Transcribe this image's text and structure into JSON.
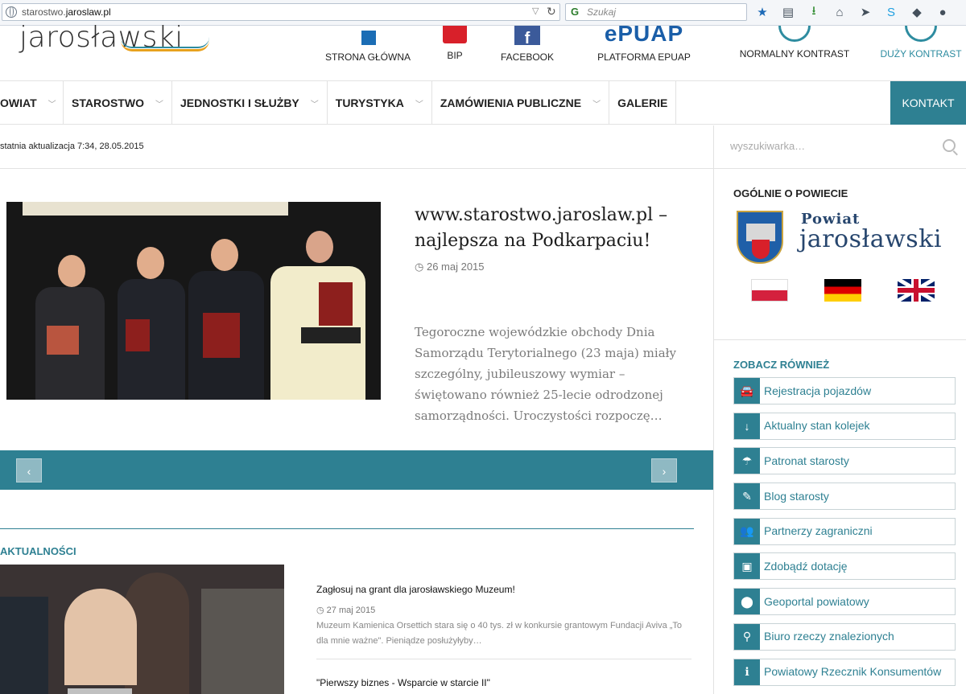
{
  "browser": {
    "url_prefix": "starostwo.",
    "url_domain": "jaroslaw.pl",
    "search_placeholder": "Szukaj",
    "toolbar_icons": [
      "star-icon",
      "reading-list-icon",
      "download-icon",
      "home-icon",
      "send-icon",
      "skype-icon",
      "pocket-icon",
      "chat-icon"
    ]
  },
  "header": {
    "logo_text": "jarosławski",
    "quick_links": [
      {
        "label": "STRONA GŁÓWNA",
        "icon": "home-icon"
      },
      {
        "label": "BIP",
        "icon": "bip-icon"
      },
      {
        "label": "FACEBOOK",
        "icon": "facebook-icon"
      },
      {
        "label": "PLATFORMA EPUAP",
        "icon": "epuap-logo"
      },
      {
        "label": "NORMALNY KONTRAST",
        "icon": "contrast-normal-icon"
      },
      {
        "label": "DUŻY KONTRAST",
        "icon": "contrast-high-icon"
      }
    ],
    "epuap_logo": "ePUAP"
  },
  "nav": {
    "items": [
      {
        "label": "OWIAT"
      },
      {
        "label": "STAROSTWO"
      },
      {
        "label": "JEDNOSTKI I SŁUŻBY"
      },
      {
        "label": "TURYSTYKA"
      },
      {
        "label": "ZAMÓWIENIA PUBLICZNE"
      },
      {
        "label": "GALERIE"
      }
    ],
    "contact": "KONTAKT"
  },
  "main": {
    "last_update": "statnia aktualizacja 7:34, 28.05.2015",
    "slide": {
      "title": "www.starostwo.jaroslaw.pl – najlepsza na Podkarpaciu!",
      "date": "26 maj 2015",
      "excerpt": "Tegoroczne wojewódzkie obchody Dnia Samorządu Terytorialnego (23 maja) miały szczególny, jubileuszowy wymiar – świętowano również 25-lecie odrodzonej samorządności. Uroczystości rozpoczę…"
    },
    "slider_prev": "‹",
    "slider_next": "›",
    "news_heading": "AKTUALNOŚCI",
    "news": [
      {
        "title": "Zagłosuj na grant dla jarosławskiego Muzeum!",
        "date": "27 maj 2015",
        "excerpt": "Muzeum Kamienica Orsettich stara się o 40 tys. zł w konkursie grantowym Fundacji Aviva „To dla mnie ważne\". Pieniądze posłużyłyby…"
      },
      {
        "title": "\"Pierwszy biznes - Wsparcie w starcie II\""
      }
    ]
  },
  "sidebar": {
    "search_placeholder": "wyszukiwarka…",
    "about_heading": "OGÓLNIE O POWIECIE",
    "powiat_small": "Powiat",
    "powiat_big": "jarosławski",
    "see_also_heading": "ZOBACZ RÓWNIEŻ",
    "links": [
      {
        "label": "Rejestracja pojazdów",
        "icon": "car-icon",
        "glyph": "🚘"
      },
      {
        "label": "Aktualny stan kolejek",
        "icon": "sort-numeric-icon",
        "glyph": "↓"
      },
      {
        "label": "Patronat starosty",
        "icon": "umbrella-icon",
        "glyph": "☂"
      },
      {
        "label": "Blog starosty",
        "icon": "pencil-icon",
        "glyph": "✎"
      },
      {
        "label": "Partnerzy zagraniczni",
        "icon": "users-icon",
        "glyph": "👥"
      },
      {
        "label": "Zdobądź dotację",
        "icon": "money-icon",
        "glyph": "▣"
      },
      {
        "label": "Geoportal powiatowy",
        "icon": "map-marker-icon",
        "glyph": "⬤"
      },
      {
        "label": "Biuro rzeczy znalezionych",
        "icon": "search-icon",
        "glyph": "⚲"
      },
      {
        "label": "Powiatowy Rzecznik Konsumentów",
        "icon": "info-icon",
        "glyph": "ℹ"
      }
    ]
  },
  "colors": {
    "accent": "#2e8092",
    "brand_dark": "#27466e"
  }
}
